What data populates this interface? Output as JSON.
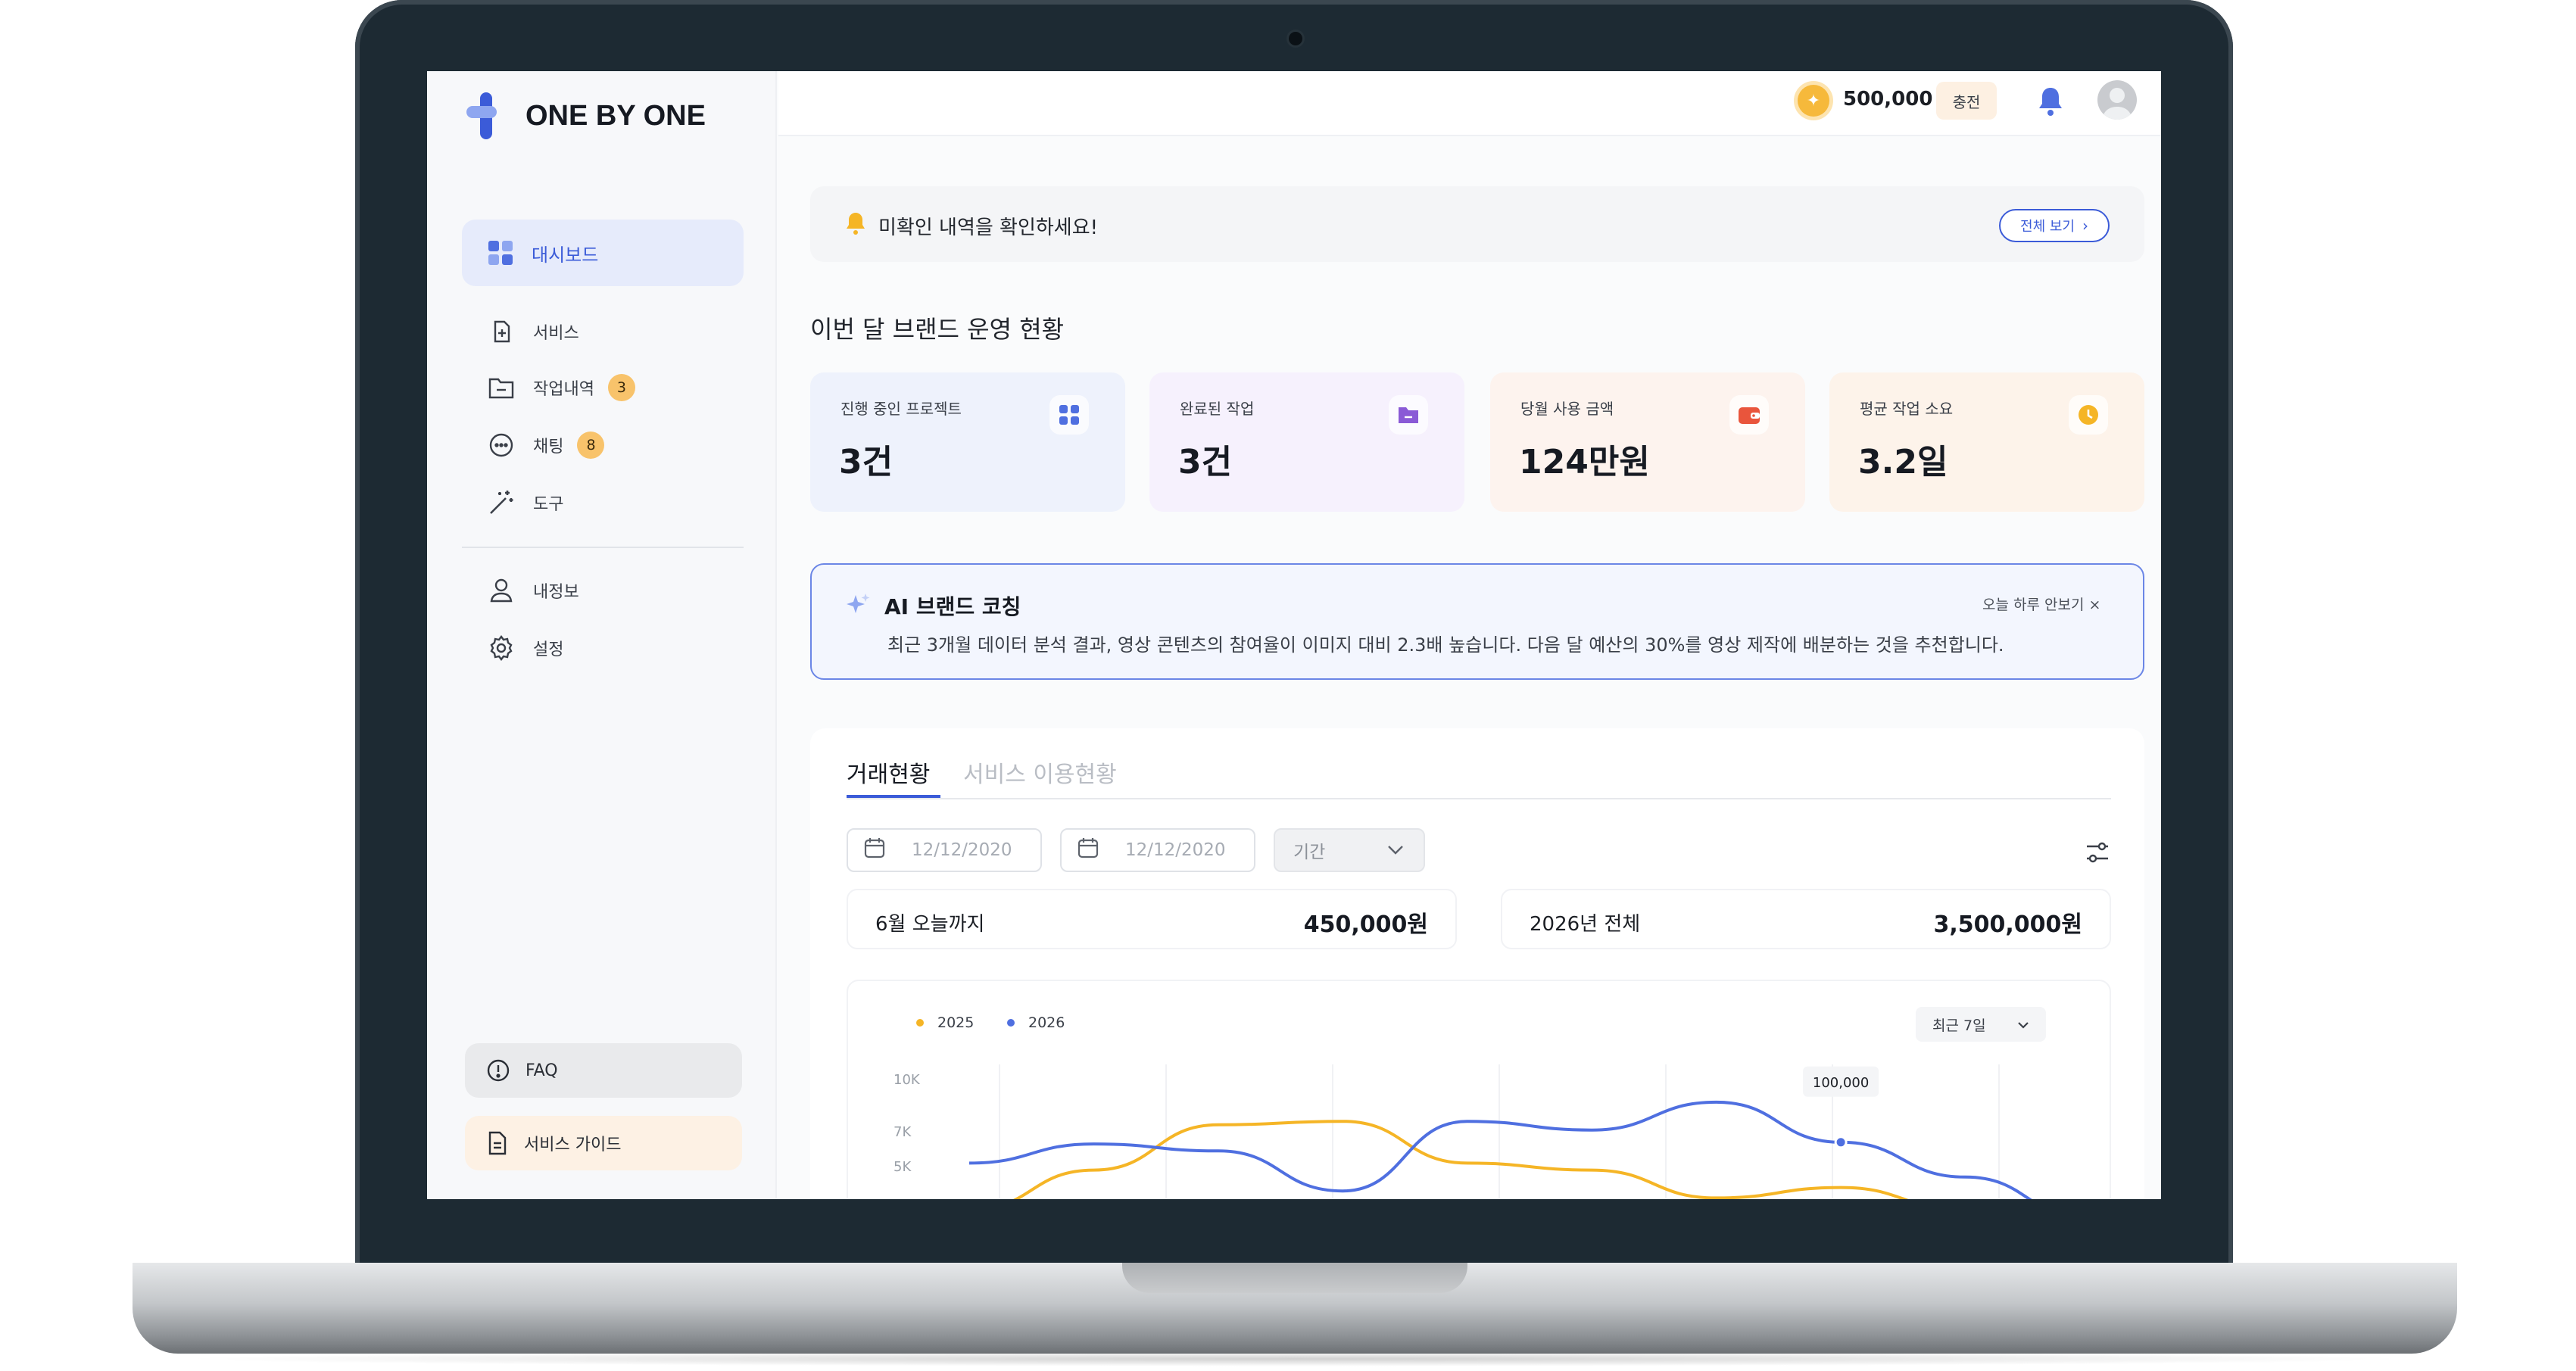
{
  "app": {
    "logo_text": "ONE BY ONE"
  },
  "colors": {
    "accent": "#3b5bd8",
    "series_2025": "#f5b526",
    "series_2026": "#4f6fe0"
  },
  "sidebar": {
    "active": {
      "label": "대시보드",
      "icon": "dashboard-grid-icon"
    },
    "items": [
      {
        "label": "서비스",
        "icon": "service-add-icon"
      },
      {
        "label": "작업내역",
        "icon": "folder-icon",
        "badge": "3"
      },
      {
        "label": "채팅",
        "icon": "chat-bubble-icon",
        "badge": "8"
      },
      {
        "label": "도구",
        "icon": "magic-wand-icon"
      }
    ],
    "items2": [
      {
        "label": "내정보",
        "icon": "user-icon"
      },
      {
        "label": "설정",
        "icon": "gear-icon"
      }
    ],
    "faq": "FAQ",
    "guide": "서비스 가이드"
  },
  "topbar": {
    "coins": "500,000",
    "charge": "충전"
  },
  "alert": {
    "text": "미확인 내역을 확인하세요!",
    "button": "전체 보기"
  },
  "section_title": "이번 달 브랜드 운영 현황",
  "stats": [
    {
      "label": "진행 중인 프로젝트",
      "value": "3건",
      "bg": "#eef2fc",
      "icon_color": "#4f6fe0"
    },
    {
      "label": "완료된 작업",
      "value": "3건",
      "bg": "#f6f1fd",
      "icon_color": "#8a5ad6"
    },
    {
      "label": "당월 사용 금액",
      "value": "124만원",
      "bg": "#fdf3ee",
      "icon_color": "#e9553c"
    },
    {
      "label": "평균 작업 소요",
      "value": "3.2일",
      "bg": "#fdf3ea",
      "icon_color": "#f5b526"
    }
  ],
  "coach": {
    "title": "AI 브랜드 코칭",
    "dismiss": "오늘 하루 안보기 ×",
    "body": "최근 3개월 데이터 분석 결과, 영상 콘텐츠의 참여율이 이미지 대비 2.3배 높습니다. 다음 달 예산의 30%를 영상 제작에 배분하는 것을 추천합니다."
  },
  "tabs": {
    "active": "거래현황",
    "other": "서비스 이용현황"
  },
  "filters": {
    "date_from": "12/12/2020",
    "date_to": "12/12/2020",
    "period": "기간"
  },
  "summary": [
    {
      "label": "6월 오늘까지",
      "value": "450,000원"
    },
    {
      "label": "2026년 전체",
      "value": "3,500,000원"
    }
  ],
  "chart_range": "최근 7일",
  "chart_data": {
    "type": "line",
    "yticks": [
      "10K",
      "7K",
      "5K"
    ],
    "ylim": [
      0,
      10000
    ],
    "tooltip": "100,000",
    "series": [
      {
        "name": "2025",
        "color": "#f5b526",
        "values": [
          2500,
          4800,
          7400,
          7600,
          5200,
          4800,
          3200,
          3800,
          2500,
          1800
        ]
      },
      {
        "name": "2026",
        "color": "#4f6fe0",
        "values": [
          5200,
          6300,
          5900,
          3600,
          7600,
          7100,
          8700,
          6400,
          4400,
          2000
        ]
      }
    ],
    "grid": "vertical"
  }
}
